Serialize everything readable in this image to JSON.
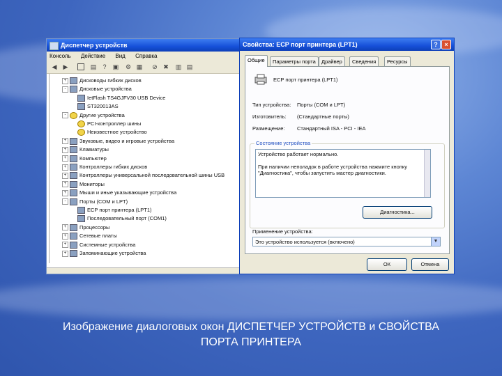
{
  "device_manager": {
    "title": "Диспетчер устройств",
    "menu": [
      "Консоль",
      "Действие",
      "Вид",
      "Справка"
    ],
    "tree": [
      {
        "label": "Дисководы гибких дисков",
        "level": 1,
        "exp": "+",
        "warn": false
      },
      {
        "label": "Дисковые устройства",
        "level": 1,
        "exp": "-",
        "warn": false
      },
      {
        "label": "IetFlash TS4GJFV30 USB Device",
        "level": 2,
        "exp": "",
        "warn": false
      },
      {
        "label": "ST320013AS",
        "level": 2,
        "exp": "",
        "warn": false
      },
      {
        "label": "Другие устройства",
        "level": 1,
        "exp": "-",
        "warn": true
      },
      {
        "label": "PCI-контроллер шины",
        "level": 2,
        "exp": "",
        "warn": true
      },
      {
        "label": "Неизвестное устройство",
        "level": 2,
        "exp": "",
        "warn": true
      },
      {
        "label": "Звуковые, видео и игровые устройства",
        "level": 1,
        "exp": "+",
        "warn": false
      },
      {
        "label": "Клавиатуры",
        "level": 1,
        "exp": "+",
        "warn": false
      },
      {
        "label": "Компьютер",
        "level": 1,
        "exp": "+",
        "warn": false
      },
      {
        "label": "Контроллеры гибких дисков",
        "level": 1,
        "exp": "+",
        "warn": false
      },
      {
        "label": "Контроллеры универсальной последовательной шины USB",
        "level": 1,
        "exp": "+",
        "warn": false
      },
      {
        "label": "Мониторы",
        "level": 1,
        "exp": "+",
        "warn": false
      },
      {
        "label": "Мыши и иные указывающие устройства",
        "level": 1,
        "exp": "+",
        "warn": false
      },
      {
        "label": "Порты (COM и LPT)",
        "level": 1,
        "exp": "-",
        "warn": false
      },
      {
        "label": "ECP порт принтера (LPT1)",
        "level": 2,
        "exp": "",
        "warn": false
      },
      {
        "label": "Последовательный порт (COM1)",
        "level": 2,
        "exp": "",
        "warn": false
      },
      {
        "label": "Процессоры",
        "level": 1,
        "exp": "+",
        "warn": false
      },
      {
        "label": "Сетевые платы",
        "level": 1,
        "exp": "+",
        "warn": false
      },
      {
        "label": "Системные устройства",
        "level": 1,
        "exp": "+",
        "warn": false
      },
      {
        "label": "Запоминающие устройства",
        "level": 1,
        "exp": "+",
        "warn": false
      }
    ]
  },
  "properties": {
    "title": "Свойства: ECP порт принтера (LPT1)",
    "help_symbol": "?",
    "close_symbol": "×",
    "tabs": [
      "Общие",
      "Параметры порта",
      "Драйвер",
      "Сведения",
      "Ресурсы"
    ],
    "device_name": "ECP порт принтера (LPT1)",
    "device_type_label": "Тип устройства:",
    "device_type_value": "Порты (COM и LPT)",
    "manufacturer_label": "Изготовитель:",
    "manufacturer_value": "(Стандартные порты)",
    "location_label": "Размещение:",
    "location_value": "Стандартный ISA - PCI - IEA",
    "status_group": "Состояние устройства",
    "status_text_1": "Устройство работает нормально.",
    "status_text_2": "При наличии неполадок в работе устройства нажмите кнопку \"Диагностика\", чтобы запустить мастер диагностики.",
    "diagnostics_button": "Диагностика...",
    "usage_label": "Применение устройства:",
    "usage_value": "Это устройство используется (включено)",
    "ok_button": "ОК",
    "cancel_button": "Отмена"
  },
  "caption_line1": "Изображение диалоговых окон ДИСПЕТЧЕР УСТРОЙСТВ и СВОЙСТВА",
  "caption_line2": "ПОРТА ПРИНТЕРА"
}
